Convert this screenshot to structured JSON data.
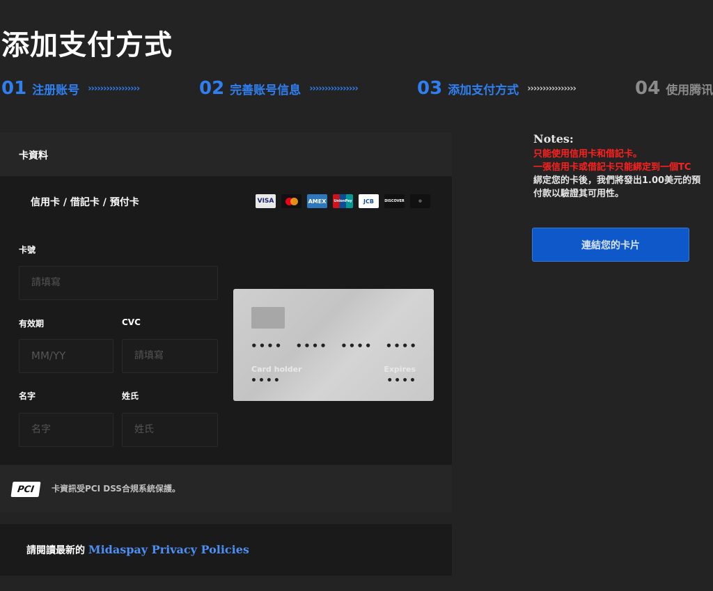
{
  "page": {
    "title": "添加支付方式"
  },
  "steps": [
    {
      "num": "01",
      "label": "注册账号",
      "arrows": "›››››››››››››››››",
      "state": "done"
    },
    {
      "num": "02",
      "label": "完善账号信息",
      "arrows": "››››››››››››››››",
      "state": "done"
    },
    {
      "num": "03",
      "label": "添加支付方式",
      "arrows": "››››››››››››››››",
      "state": "current"
    },
    {
      "num": "04",
      "label": "使用腾讯",
      "arrows": "",
      "state": "inactive"
    }
  ],
  "form": {
    "section_title": "卡資料",
    "card_types_label": "信用卡 / 借記卡 / 預付卡",
    "brands": [
      "VISA",
      "Mastercard",
      "AMEX",
      "UnionPay",
      "JCB",
      "DISCOVER",
      "Diners Club"
    ],
    "card_number": {
      "label": "卡號",
      "placeholder": "請填寫"
    },
    "expiry": {
      "label": "有效期",
      "placeholder": "MM/YY"
    },
    "cvc": {
      "label": "CVC",
      "placeholder": "請填寫"
    },
    "first_name": {
      "label": "名字",
      "placeholder": "名字"
    },
    "last_name": {
      "label": "姓氏",
      "placeholder": "姓氏"
    }
  },
  "card_preview": {
    "number_groups": [
      "••••",
      "••••",
      "••••",
      "••••"
    ],
    "holder_label": "Card holder",
    "holder_value": "••••",
    "expires_label": "Expires",
    "expires_value": "••••"
  },
  "pci": {
    "logo": "PCI",
    "text": "卡資訊受PCI DSS合規系統保護。"
  },
  "privacy": {
    "prefix": "請閱讀最新的 ",
    "link": "Midaspay Privacy Policies"
  },
  "notes": {
    "title": "Notes:",
    "lines_red": [
      "只能使用信用卡和借記卡。",
      "一張信用卡或借記卡只能綁定到一個TC"
    ],
    "lines_white": [
      "綁定您的卡後，我們將發出1.00美元的預",
      "付款以驗證其可用性。"
    ]
  },
  "actions": {
    "link_card": "連結您的卡片"
  },
  "colors": {
    "accent": "#2f7ff0",
    "button": "#0e58ca",
    "warning": "#ff2020",
    "background": "#232323"
  }
}
